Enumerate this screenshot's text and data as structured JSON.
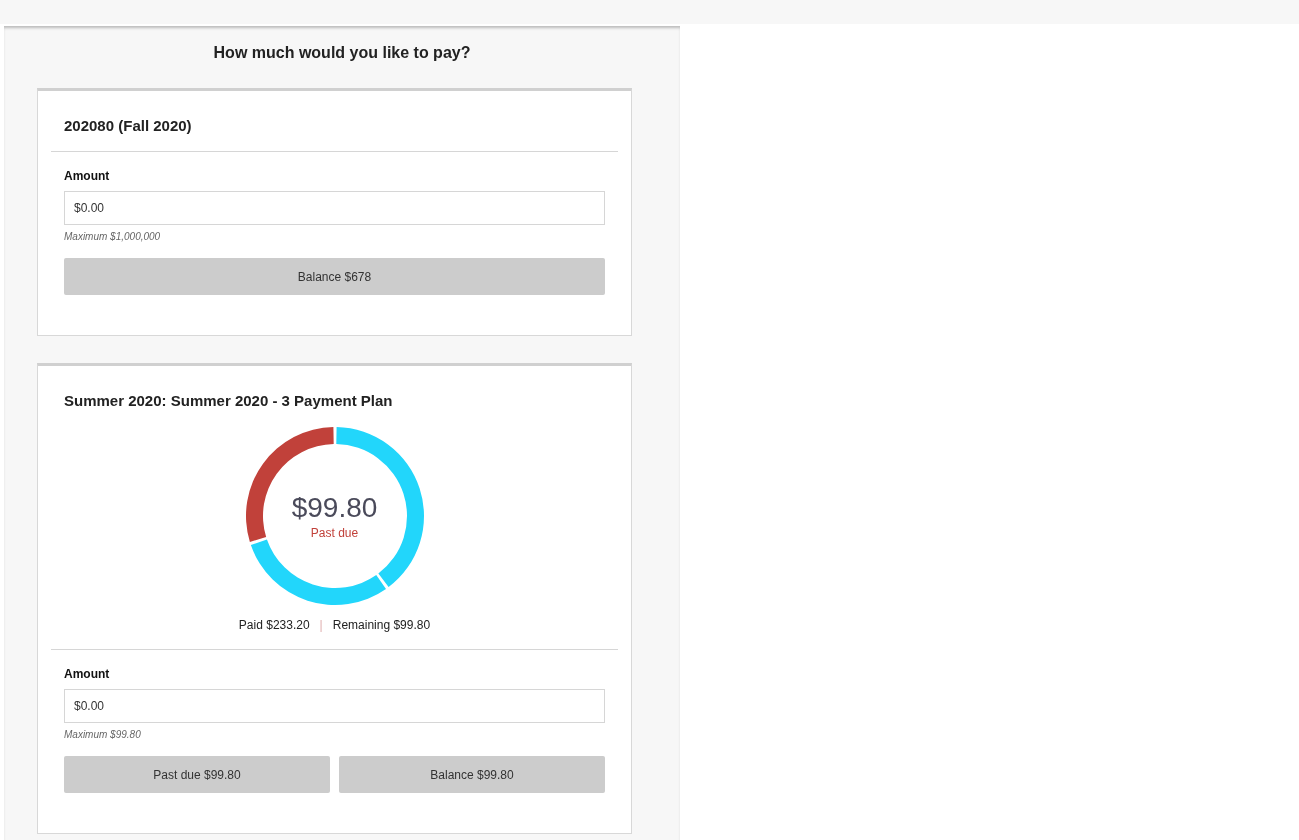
{
  "heading": "How much would you like to pay?",
  "cards": [
    {
      "kind": "simple",
      "title": "202080 (Fall 2020)",
      "amount_label": "Amount",
      "amount_value": "$0.00",
      "hint": "Maximum $1,000,000",
      "buttons": [
        "Balance $678"
      ]
    },
    {
      "kind": "plan",
      "title": "Summer 2020: Summer 2020 - 3 Payment Plan",
      "donut": {
        "amount": "$99.80",
        "status": "Past due",
        "chart_data": {
          "type": "donut",
          "values": [
            40,
            30,
            30
          ],
          "colors": [
            "#22d6fb",
            "#22d6fb",
            "#c1413a"
          ]
        }
      },
      "paid": "Paid $233.20",
      "separator": "|",
      "remaining": "Remaining $99.80",
      "amount_label": "Amount",
      "amount_value": "$0.00",
      "hint": "Maximum $99.80",
      "buttons": [
        "Past due $99.80",
        "Balance $99.80"
      ]
    }
  ]
}
